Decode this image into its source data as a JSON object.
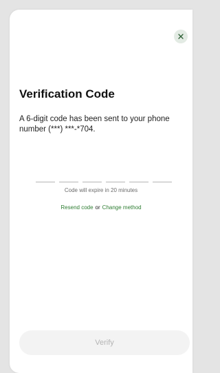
{
  "dialog": {
    "title": "Verification Code",
    "message": "A 6-digit code has been sent to your phone number (***) ***-*704.",
    "code_length": 6,
    "expire_text": "Code will expire in 20 minutes",
    "resend_label": "Resend code",
    "or_text": "or",
    "change_method_label": "Change method",
    "verify_label": "Verify",
    "close_icon": "close-icon"
  },
  "colors": {
    "link": "#2e7d32",
    "close_bg": "#e3ebe4",
    "verify_bg": "#f3f3f3",
    "verify_text": "#b4b4b4"
  }
}
